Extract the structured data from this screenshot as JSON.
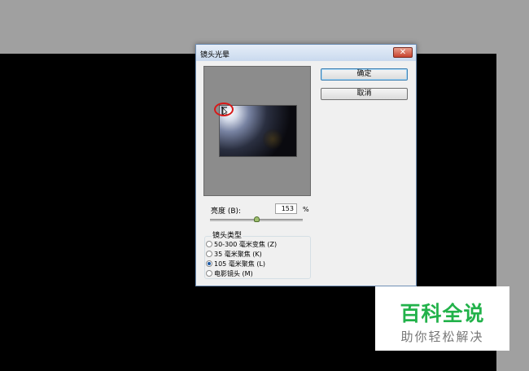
{
  "dialog": {
    "title": "镜头光晕",
    "close_glyph": "✕",
    "ok_label": "确定",
    "cancel_label": "取消"
  },
  "brightness": {
    "label": "亮度 (B):",
    "value": "153",
    "unit": "%",
    "slider_fraction": 0.5
  },
  "lens_type": {
    "label": "镜头类型",
    "options": [
      {
        "label": "50-300 毫米变焦 (Z)",
        "selected": false
      },
      {
        "label": "35 毫米聚焦 (K)",
        "selected": false
      },
      {
        "label": "105 毫米聚焦 (L)",
        "selected": true
      },
      {
        "label": "电影镜头 (M)",
        "selected": false
      }
    ]
  },
  "watermark": {
    "main": "百科全说",
    "sub": "助你轻松解决"
  },
  "colors": {
    "canvas": "#000000",
    "workspace": "#a0a0a0",
    "annotation_circle": "#d81818",
    "watermark_green": "#22b24a"
  }
}
